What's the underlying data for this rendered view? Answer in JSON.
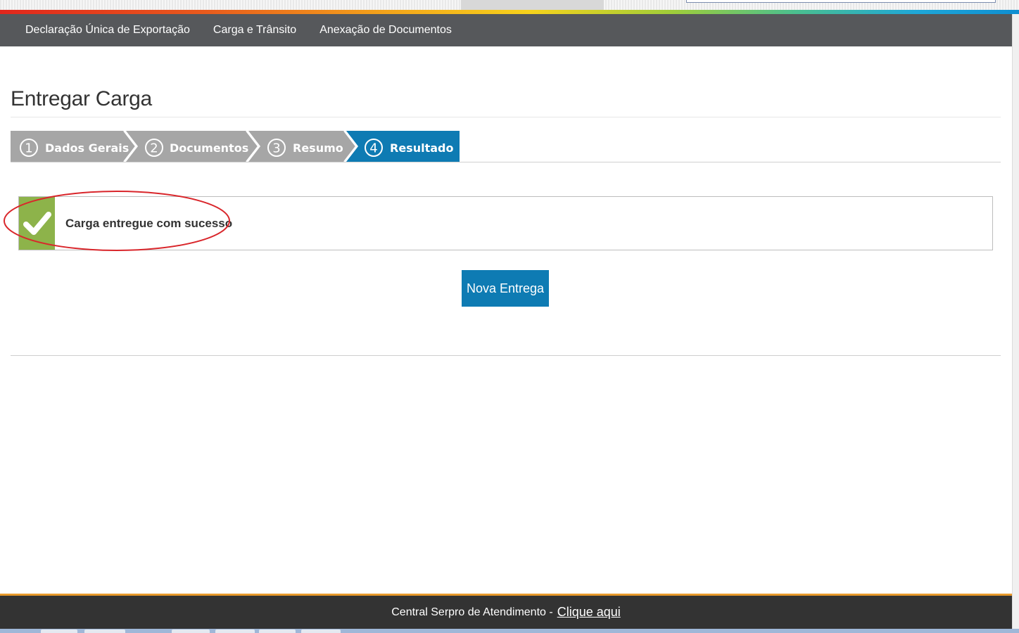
{
  "nav": {
    "items": [
      "Declaração Única de Exportação",
      "Carga e Trânsito",
      "Anexação de Documentos"
    ]
  },
  "page": {
    "title": "Entregar Carga"
  },
  "wizard": {
    "steps": [
      {
        "number": "1",
        "label": "Dados Gerais",
        "active": false
      },
      {
        "number": "2",
        "label": "Documentos",
        "active": false
      },
      {
        "number": "3",
        "label": "Resumo",
        "active": false
      },
      {
        "number": "4",
        "label": "Resultado",
        "active": true
      }
    ]
  },
  "message": {
    "text": "Carga entregue com sucesso",
    "icon": "check-icon"
  },
  "actions": {
    "new_delivery_label": "Nova Entrega"
  },
  "footer": {
    "text": "Central Serpro de Atendimento -",
    "link": "Clique aqui"
  },
  "colors": {
    "nav_bg": "#56585b",
    "step_inactive": "#a6a6a6",
    "step_active": "#0e7bb3",
    "success_green": "#8db34a",
    "footer_bg": "#333333",
    "annotation_red": "#d9262b"
  }
}
